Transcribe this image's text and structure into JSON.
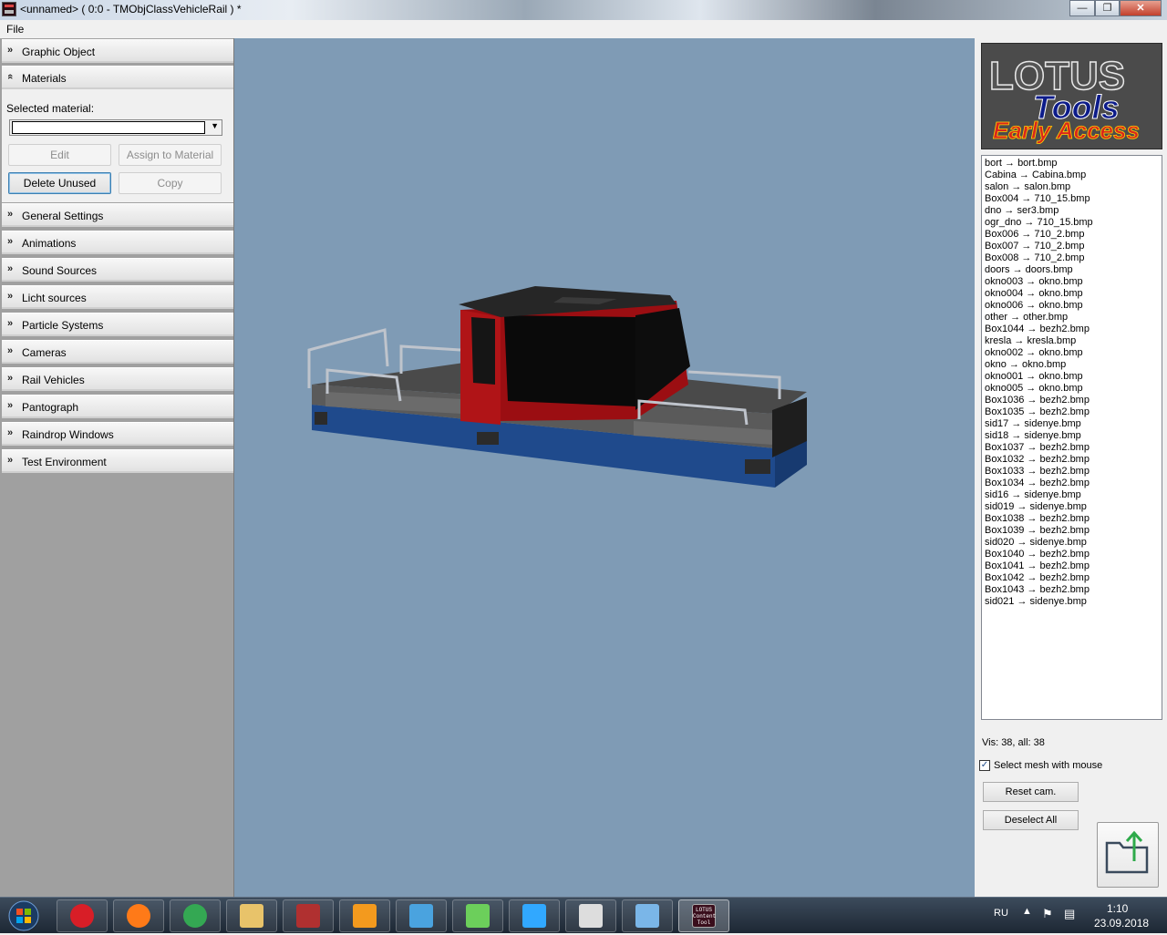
{
  "window": {
    "title": "<unnamed> ( 0:0 - TMObjClassVehicleRail ) *",
    "minimize_glyph": "—",
    "maximize_glyph": "❐",
    "close_glyph": "✕"
  },
  "menu": {
    "file": "File"
  },
  "left_panel": {
    "chevron_collapsed": "»",
    "chevron_expanded": "«",
    "categories": [
      {
        "label": "Graphic Object"
      },
      {
        "label": "Materials"
      },
      {
        "label": "General Settings"
      },
      {
        "label": "Animations"
      },
      {
        "label": "Sound Sources"
      },
      {
        "label": "Licht sources"
      },
      {
        "label": "Particle Systems"
      },
      {
        "label": "Cameras"
      },
      {
        "label": "Rail Vehicles"
      },
      {
        "label": "Pantograph"
      },
      {
        "label": "Raindrop Windows"
      },
      {
        "label": "Test Environment"
      }
    ],
    "materials": {
      "selected_label": "Selected material:",
      "selected_value": "",
      "edit": "Edit",
      "assign": "Assign to Material",
      "delete_unused": "Delete Unused",
      "copy": "Copy"
    }
  },
  "right_panel": {
    "logo": {
      "line1": "LOTUS",
      "line2": "Tools",
      "line3": "Early Access"
    },
    "meshes": [
      "bort → bort.bmp",
      "Cabina → Cabina.bmp",
      "salon → salon.bmp",
      "Box004 → 710_15.bmp",
      "dno → ser3.bmp",
      "ogr_dno → 710_15.bmp",
      "Box006 → 710_2.bmp",
      "Box007 → 710_2.bmp",
      "Box008 → 710_2.bmp",
      "doors → doors.bmp",
      "okno003 → okno.bmp",
      "okno004 → okno.bmp",
      "okno006 → okno.bmp",
      "other → other.bmp",
      "Box1044 → bezh2.bmp",
      "kresla → kresla.bmp",
      "okno002 → okno.bmp",
      "okno → okno.bmp",
      "okno001 → okno.bmp",
      "okno005 → okno.bmp",
      "Box1036 → bezh2.bmp",
      "Box1035 → bezh2.bmp",
      "sid17 → sidenye.bmp",
      "sid18 → sidenye.bmp",
      "Box1037 → bezh2.bmp",
      "Box1032 → bezh2.bmp",
      "Box1033 → bezh2.bmp",
      "Box1034 → bezh2.bmp",
      "sid16 → sidenye.bmp",
      "sid019 → sidenye.bmp",
      "Box1038 → bezh2.bmp",
      "Box1039 → bezh2.bmp",
      "sid020 → sidenye.bmp",
      "Box1040 → bezh2.bmp",
      "Box1041 → bezh2.bmp",
      "Box1042 → bezh2.bmp",
      "Box1043 → bezh2.bmp",
      "sid021 → sidenye.bmp"
    ],
    "vis_text": "Vis: 38, all: 38",
    "select_mesh_label": "Select mesh with mouse",
    "select_mesh_checked": true,
    "check_glyph": "✓",
    "reset_cam": "Reset cam.",
    "deselect_all": "Deselect All"
  },
  "taskbar": {
    "apps": [
      {
        "icon": "opera-icon",
        "color": "#d81e27"
      },
      {
        "icon": "firefox-icon",
        "color": "#ff7a18"
      },
      {
        "icon": "chrome-icon",
        "color": "#34a853"
      },
      {
        "icon": "file-explorer-icon",
        "color": "#e8c36a"
      },
      {
        "icon": "train-app-icon",
        "color": "#b03030"
      },
      {
        "icon": "media-player-icon",
        "color": "#f39a1e"
      },
      {
        "icon": "remote-desktop-icon",
        "color": "#4aa3df"
      },
      {
        "icon": "monitor-app-icon",
        "color": "#6ccf5b"
      },
      {
        "icon": "photoshop-icon",
        "color": "#31a8ff"
      },
      {
        "icon": "3d-app-icon",
        "color": "#dddddd"
      },
      {
        "icon": "image-viewer-icon",
        "color": "#7ab6e8"
      },
      {
        "icon": "lotus-content-tool-icon",
        "color": "#3a0e1c"
      }
    ],
    "lotus_label_1": "LOTUS",
    "lotus_label_2": "Content",
    "lotus_label_3": "Tool",
    "language": "RU",
    "time": "1:10",
    "date": "23.09.2018"
  },
  "colors": {
    "viewport_bg": "#7f9bb5",
    "vehicle_red": "#9b0e12",
    "vehicle_blue": "#1f4a8c",
    "logo_red": "#d9261c",
    "logo_blue": "#0d1c8a"
  }
}
